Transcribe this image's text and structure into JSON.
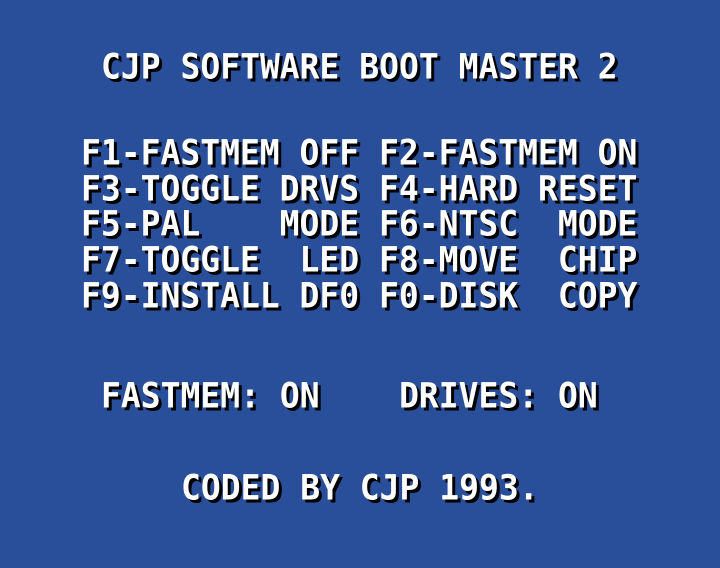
{
  "title": "CJP SOFTWARE BOOT MASTER 2",
  "menu": [
    {
      "left": "F1-FASTMEM OFF",
      "right": "F2-FASTMEM ON"
    },
    {
      "left": "F3-TOGGLE DRVS",
      "right": "F4-HARD RESET"
    },
    {
      "left": "F5-PAL    MODE",
      "right": "F6-NTSC  MODE"
    },
    {
      "left": "F7-TOGGLE  LED",
      "right": "F8-MOVE  CHIP"
    },
    {
      "left": "F9-INSTALL DF0",
      "right": "F0-DISK  COPY"
    }
  ],
  "status": {
    "fastmem_label": "FASTMEM:",
    "fastmem_value": "ON",
    "drives_label": "DRIVES:",
    "drives_value": "ON"
  },
  "credit": "CODED BY CJP 1993.",
  "colors": {
    "background": "#2a4f9a",
    "text": "#ffffff",
    "shadow": "#000000"
  }
}
